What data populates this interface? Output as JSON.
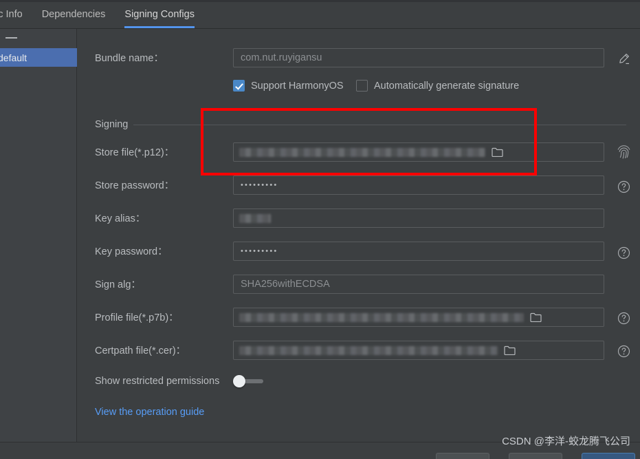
{
  "tabs": [
    {
      "label": "ic Info",
      "active": false
    },
    {
      "label": "Dependencies",
      "active": false
    },
    {
      "label": "Signing Configs",
      "active": true
    }
  ],
  "sidebar": {
    "remove_label": "—",
    "items": [
      {
        "label": "default",
        "selected": true
      }
    ]
  },
  "form": {
    "bundle_name": {
      "label": "Bundle name：",
      "value": "com.nut.ruyigansu",
      "placeholder": "com.nut.ruyigansu"
    },
    "checkboxes": [
      {
        "label": "Support HarmonyOS",
        "checked": true
      },
      {
        "label": "Automatically generate signature",
        "checked": false
      }
    ],
    "section_title": "Signing",
    "fields": [
      {
        "label": "Store file(*.p12)：",
        "value": "",
        "kind": "file-redacted",
        "icon": "folder-icon",
        "rail_icon": "fingerprint-icon"
      },
      {
        "label": "Store password：",
        "value": "•••••••••",
        "kind": "password",
        "rail_icon": "help-icon"
      },
      {
        "label": "Key alias：",
        "value": "",
        "kind": "text-redacted",
        "rail_icon": ""
      },
      {
        "label": "Key password：",
        "value": "•••••••••",
        "kind": "password",
        "rail_icon": "help-icon"
      },
      {
        "label": "Sign alg：",
        "value": "SHA256withECDSA",
        "kind": "text",
        "rail_icon": ""
      },
      {
        "label": "Profile file(*.p7b)：",
        "value": "",
        "kind": "file-redacted",
        "icon": "folder-icon",
        "rail_icon": "help-icon"
      },
      {
        "label": "Certpath file(*.cer)：",
        "value": "",
        "kind": "file-redacted",
        "icon": "folder-icon",
        "rail_icon": "help-icon"
      }
    ],
    "toggle": {
      "label": "Show restricted permissions",
      "on": false
    },
    "guide_link": "View the operation guide",
    "edit_icon": "pencil-icon"
  },
  "watermark": "CSDN @李洋-蛟龙腾飞公司",
  "colors": {
    "accent": "#5394ec",
    "selection": "#4b6eaf",
    "link": "#589df6",
    "annotation": "#fe0000",
    "panel_bg": "#3c3f41",
    "sidebar_bg": "#3f4245",
    "checkbox_on": "#4a88c7"
  }
}
